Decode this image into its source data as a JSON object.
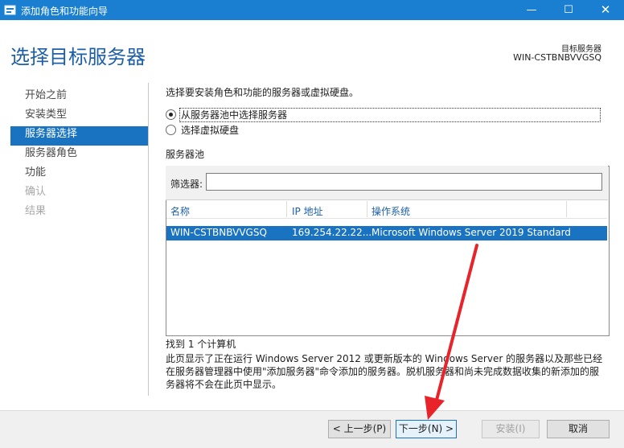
{
  "window": {
    "title": "添加角色和功能向导",
    "min_glyph": "—",
    "max_glyph": "☐",
    "close_glyph": "✕"
  },
  "header": {
    "page_title": "选择目标服务器",
    "dest_label": "目标服务器",
    "dest_server": "WIN-CSTBNBVVGSQ"
  },
  "nav": {
    "items": [
      {
        "label": "开始之前",
        "state": "normal"
      },
      {
        "label": "安装类型",
        "state": "normal"
      },
      {
        "label": "服务器选择",
        "state": "active"
      },
      {
        "label": "服务器角色",
        "state": "normal"
      },
      {
        "label": "功能",
        "state": "normal"
      },
      {
        "label": "确认",
        "state": "disabled"
      },
      {
        "label": "结果",
        "state": "disabled"
      }
    ]
  },
  "main": {
    "intro": "选择要安装角色和功能的服务器或虚拟硬盘。",
    "option_pool": "从服务器池中选择服务器",
    "option_vhd": "选择虚拟硬盘",
    "selected_option": "option_pool",
    "pool_title": "服务器池",
    "filter_label": "筛选器:",
    "filter_value": "",
    "columns": [
      "名称",
      "IP 地址",
      "操作系统"
    ],
    "rows": [
      [
        "WIN-CSTBNBVVGSQ",
        "169.254.22.22...",
        "Microsoft Windows Server 2019 Standard"
      ]
    ],
    "found_text": "找到 1 个计算机",
    "description": "此页显示了正在运行 Windows Server 2012 或更新版本的 Windows Server 的服务器以及那些已经在服务器管理器中使用\"添加服务器\"命令添加的服务器。脱机服务器和尚未完成数据收集的新添加的服务器将不会在此页中显示。"
  },
  "footer": {
    "prev_label": "< 上一步(P)",
    "next_label": "下一步(N) >",
    "install_label": "安装(I)",
    "cancel_label": "取消"
  },
  "colors": {
    "titlebar": "#1a7fd0",
    "accent": "#1a73c0",
    "title_text": "#1d5fa8",
    "annotation_arrow": "#e8242a"
  }
}
